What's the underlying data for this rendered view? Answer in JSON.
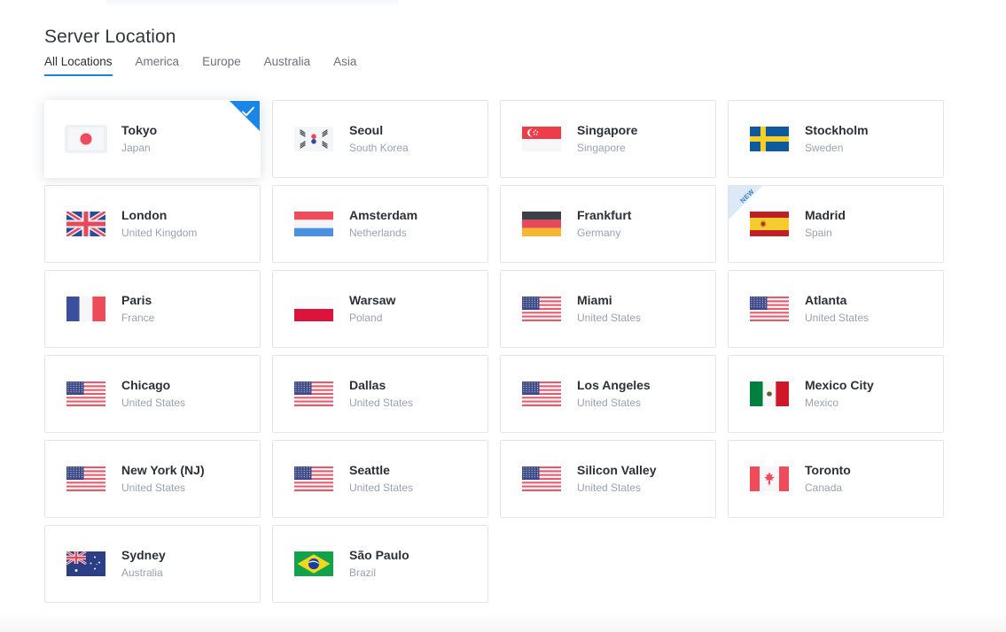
{
  "page": {
    "title": "Server Location"
  },
  "tabs": [
    {
      "label": "All Locations",
      "active": true
    },
    {
      "label": "America",
      "active": false
    },
    {
      "label": "Europe",
      "active": false
    },
    {
      "label": "Australia",
      "active": false
    },
    {
      "label": "Asia",
      "active": false
    }
  ],
  "badges": {
    "new_label": "NEW",
    "selected_icon": "check-icon"
  },
  "colors": {
    "accent": "#1a87d6",
    "selected_corner": "#1a86e8",
    "new_ribbon_bg": "#dce9f7",
    "new_ribbon_text": "#3f7fc4",
    "card_border": "#e3e5e8",
    "city_text": "#2c3136",
    "country_text": "#9aa2ad",
    "page_bg": "#ffffff"
  },
  "locations": [
    {
      "city": "Tokyo",
      "country": "Japan",
      "flag": "jp",
      "selected": true,
      "new": false
    },
    {
      "city": "Seoul",
      "country": "South Korea",
      "flag": "kr",
      "selected": false,
      "new": false
    },
    {
      "city": "Singapore",
      "country": "Singapore",
      "flag": "sg",
      "selected": false,
      "new": false
    },
    {
      "city": "Stockholm",
      "country": "Sweden",
      "flag": "se",
      "selected": false,
      "new": false
    },
    {
      "city": "London",
      "country": "United Kingdom",
      "flag": "gb",
      "selected": false,
      "new": false
    },
    {
      "city": "Amsterdam",
      "country": "Netherlands",
      "flag": "nl",
      "selected": false,
      "new": false
    },
    {
      "city": "Frankfurt",
      "country": "Germany",
      "flag": "de",
      "selected": false,
      "new": false
    },
    {
      "city": "Madrid",
      "country": "Spain",
      "flag": "es",
      "selected": false,
      "new": true
    },
    {
      "city": "Paris",
      "country": "France",
      "flag": "fr",
      "selected": false,
      "new": false
    },
    {
      "city": "Warsaw",
      "country": "Poland",
      "flag": "pl",
      "selected": false,
      "new": false
    },
    {
      "city": "Miami",
      "country": "United States",
      "flag": "us",
      "selected": false,
      "new": false
    },
    {
      "city": "Atlanta",
      "country": "United States",
      "flag": "us",
      "selected": false,
      "new": false
    },
    {
      "city": "Chicago",
      "country": "United States",
      "flag": "us",
      "selected": false,
      "new": false
    },
    {
      "city": "Dallas",
      "country": "United States",
      "flag": "us",
      "selected": false,
      "new": false
    },
    {
      "city": "Los Angeles",
      "country": "United States",
      "flag": "us",
      "selected": false,
      "new": false
    },
    {
      "city": "Mexico City",
      "country": "Mexico",
      "flag": "mx",
      "selected": false,
      "new": false
    },
    {
      "city": "New York (NJ)",
      "country": "United States",
      "flag": "us",
      "selected": false,
      "new": false
    },
    {
      "city": "Seattle",
      "country": "United States",
      "flag": "us",
      "selected": false,
      "new": false
    },
    {
      "city": "Silicon Valley",
      "country": "United States",
      "flag": "us",
      "selected": false,
      "new": false
    },
    {
      "city": "Toronto",
      "country": "Canada",
      "flag": "ca",
      "selected": false,
      "new": false
    },
    {
      "city": "Sydney",
      "country": "Australia",
      "flag": "au",
      "selected": false,
      "new": false
    },
    {
      "city": "São Paulo",
      "country": "Brazil",
      "flag": "br",
      "selected": false,
      "new": false
    }
  ]
}
